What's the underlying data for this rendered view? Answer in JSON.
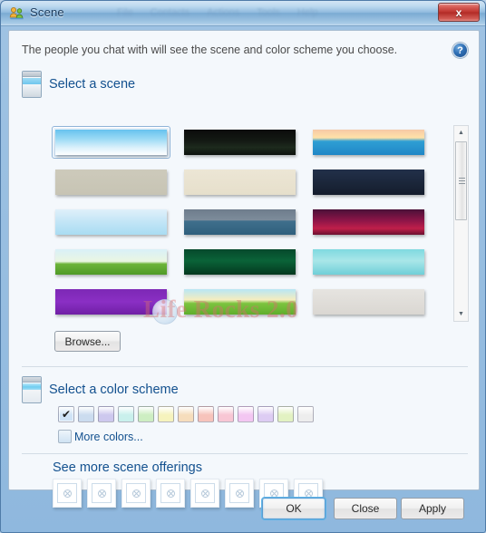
{
  "window": {
    "title": "Scene",
    "icon": "people-icon",
    "close_label": "x",
    "ghost_menu": [
      "File",
      "Contacts",
      "Actions",
      "Tools",
      "Help"
    ]
  },
  "header": {
    "intro": "The people you chat with will see the scene and color scheme you choose.",
    "help_icon": "help-icon",
    "help_label": "?"
  },
  "scene_section": {
    "title": "Select a scene",
    "browse_label": "Browse...",
    "scenes": [
      {
        "name": "blue-sky-default",
        "selected": true,
        "css": "linear-gradient(to bottom,#66c2ee 0%,#9ddbf5 38%,#d9f0fb 70%,#ffffff 100%)"
      },
      {
        "name": "dark-green-waves",
        "selected": false,
        "css": "linear-gradient(to bottom,#0b0b0b 0%,#141a14 45%,#1d2a1d 70%,#0d120d 100%)"
      },
      {
        "name": "sunset-boat-sea",
        "selected": false,
        "css": "linear-gradient(to bottom,#f6c9a6 0%,#ffe2a8 32%,#2f9fd4 46%,#1f86c6 100%)"
      },
      {
        "name": "grey-botanical",
        "selected": false,
        "css": "linear-gradient(to bottom,#cdcabb 0%,#c7c4b4 100%)"
      },
      {
        "name": "orange-bubbles",
        "selected": false,
        "css": "linear-gradient(to bottom,#ece6d5 0%,#e6dfcb 100%)"
      },
      {
        "name": "night-clouds",
        "selected": false,
        "css": "linear-gradient(to bottom,#22304a 0%,#1a2538 60%,#141c2c 100%)"
      },
      {
        "name": "ice-crystal",
        "selected": false,
        "css": "linear-gradient(to bottom,#dff0fa 0%,#bfe4f6 55%,#a9dcf2 100%)"
      },
      {
        "name": "moon-rocket-sea",
        "selected": false,
        "css": "linear-gradient(to bottom,#6e7c8c 0%,#7d8c9b 42%,#3f6f8c 46%,#2f5f7d 100%)"
      },
      {
        "name": "pink-hearts",
        "selected": false,
        "css": "linear-gradient(to bottom,#4a1038 0%,#8e1548 45%,#c01f4a 75%,#6b1030 100%)"
      },
      {
        "name": "green-field-tree",
        "selected": false,
        "css": "linear-gradient(to bottom,#d9f0f8 0%,#eaf6e2 48%,#6cb43a 58%,#4f9a27 100%)"
      },
      {
        "name": "dark-green-grass",
        "selected": false,
        "css": "linear-gradient(to bottom,#06492c 0%,#0a6338 45%,#04381f 100%)"
      },
      {
        "name": "blue-bird-flight",
        "selected": false,
        "css": "linear-gradient(to bottom,#7fd9e0 0%,#a9e6e8 45%,#6fcfd8 100%)"
      },
      {
        "name": "purple-swirls",
        "selected": false,
        "css": "linear-gradient(to bottom,#7d28b5 0%,#8a2fc4 50%,#6f1fa5 100%)"
      },
      {
        "name": "girl-green-hill",
        "selected": false,
        "css": "linear-gradient(to bottom,#b8e6f5 0%,#f5edbf 42%,#7cc43f 56%,#5fae2c 100%)"
      },
      {
        "name": "graffiti-bird",
        "selected": false,
        "css": "linear-gradient(to bottom,#e6e4e0 0%,#dad7d2 100%)"
      }
    ]
  },
  "color_section": {
    "title": "Select a color scheme",
    "more_colors_label": "More colors...",
    "swatches": [
      {
        "name": "swatch-blue-default",
        "color": "#cfe3f6",
        "selected": true
      },
      {
        "name": "swatch-steel-blue",
        "color": "#cbdcef",
        "selected": false
      },
      {
        "name": "swatch-lavender",
        "color": "#cdc8ee",
        "selected": false
      },
      {
        "name": "swatch-aqua",
        "color": "#c9f0ec",
        "selected": false
      },
      {
        "name": "swatch-green",
        "color": "#cdeec2",
        "selected": false
      },
      {
        "name": "swatch-yellow",
        "color": "#f6f3bd",
        "selected": false
      },
      {
        "name": "swatch-peach",
        "color": "#f6ddbc",
        "selected": false
      },
      {
        "name": "swatch-salmon",
        "color": "#f7c3bb",
        "selected": false
      },
      {
        "name": "swatch-pink",
        "color": "#f8c6d4",
        "selected": false
      },
      {
        "name": "swatch-magenta",
        "color": "#f3c6f2",
        "selected": false
      },
      {
        "name": "swatch-violet",
        "color": "#ddccf3",
        "selected": false
      },
      {
        "name": "swatch-lime",
        "color": "#e2f2c2",
        "selected": false
      },
      {
        "name": "swatch-grey",
        "color": "#ededed",
        "selected": false
      }
    ],
    "check_mark": "✔"
  },
  "offerings_section": {
    "title": "See more scene offerings",
    "items": [
      {
        "name": "offering-1",
        "icon": "broken-image-icon"
      },
      {
        "name": "offering-2",
        "icon": "broken-image-icon"
      },
      {
        "name": "offering-3",
        "icon": "broken-image-icon"
      },
      {
        "name": "offering-4",
        "icon": "broken-image-icon"
      },
      {
        "name": "offering-5",
        "icon": "broken-image-icon"
      },
      {
        "name": "offering-6",
        "icon": "broken-image-icon"
      },
      {
        "name": "offering-7",
        "icon": "broken-image-icon"
      },
      {
        "name": "offering-8",
        "icon": "broken-image-icon"
      }
    ]
  },
  "scrollbar": {
    "up_arrow": "▲",
    "down_arrow": "▼"
  },
  "footer": {
    "ok_label": "OK",
    "close_label": "Close",
    "apply_label": "Apply"
  },
  "watermark": {
    "text": "Life Rocks 2.0"
  }
}
